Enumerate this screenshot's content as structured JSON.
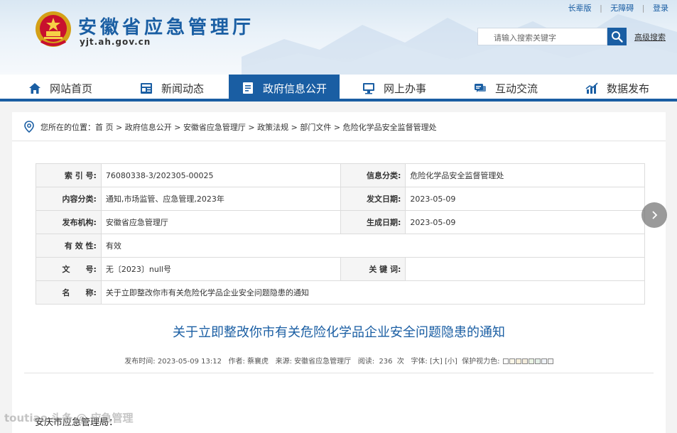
{
  "top_links": [
    "长辈版",
    "无障碍",
    "登录"
  ],
  "site": {
    "title": "安徽省应急管理厅",
    "domain": "yjt.ah.gov.cn"
  },
  "search": {
    "placeholder": "请输入搜索关键字",
    "advanced_label": "高级搜索"
  },
  "nav": {
    "items": [
      {
        "label": "网站首页",
        "icon": "home-icon"
      },
      {
        "label": "新闻动态",
        "icon": "news-icon"
      },
      {
        "label": "政府信息公开",
        "icon": "document-icon",
        "active": true
      },
      {
        "label": "网上办事",
        "icon": "monitor-icon"
      },
      {
        "label": "互动交流",
        "icon": "chat-icon"
      },
      {
        "label": "数据发布",
        "icon": "chart-icon"
      }
    ]
  },
  "breadcrumb": {
    "prefix": "您所在的位置：",
    "items": [
      "首 页",
      "政府信息公开",
      "安徽省应急管理厅",
      "政策法规",
      "部门文件",
      "危险化学品安全监督管理处"
    ]
  },
  "meta": {
    "index_no_label": "索 引 号:",
    "index_no": "76080338-3/202305-00025",
    "info_category_label": "信息分类:",
    "info_category": "危险化学品安全监督管理处",
    "content_category_label": "内容分类:",
    "content_category": "通知,市场监管、应急管理,2023年",
    "issue_date_label": "发文日期:",
    "issue_date": "2023-05-09",
    "publisher_label": "发布机构:",
    "publisher": "安徽省应急管理厅",
    "created_date_label": "生成日期:",
    "created_date": "2023-05-09",
    "validity_label": "有 效 性:",
    "validity": "有效",
    "doc_no_label": "文　　号:",
    "doc_no": "无〔2023〕null号",
    "keywords_label": "关 键 词:",
    "keywords": "",
    "name_label": "名　　称:",
    "name": "关于立即整改你市有关危险化学品企业安全问题隐患的通知"
  },
  "article": {
    "title": "关于立即整改你市有关危险化学品企业安全问题隐患的通知",
    "publish_time_label": "发布时间:",
    "publish_time": "2023-05-09 13:12",
    "author_label": "作者:",
    "author": "蔡襄虎",
    "source_label": "来源:",
    "source": "安徽省应急管理厅",
    "views_label": "阅读:",
    "views": "236",
    "views_unit": "次",
    "font_label": "字体:",
    "font_large": "[大]",
    "font_small": "[小]",
    "eye_label": "保护视力色:",
    "body_first_line": "安庆市应急管理局："
  },
  "watermark": "toutiao 头条 @ 应急管理"
}
